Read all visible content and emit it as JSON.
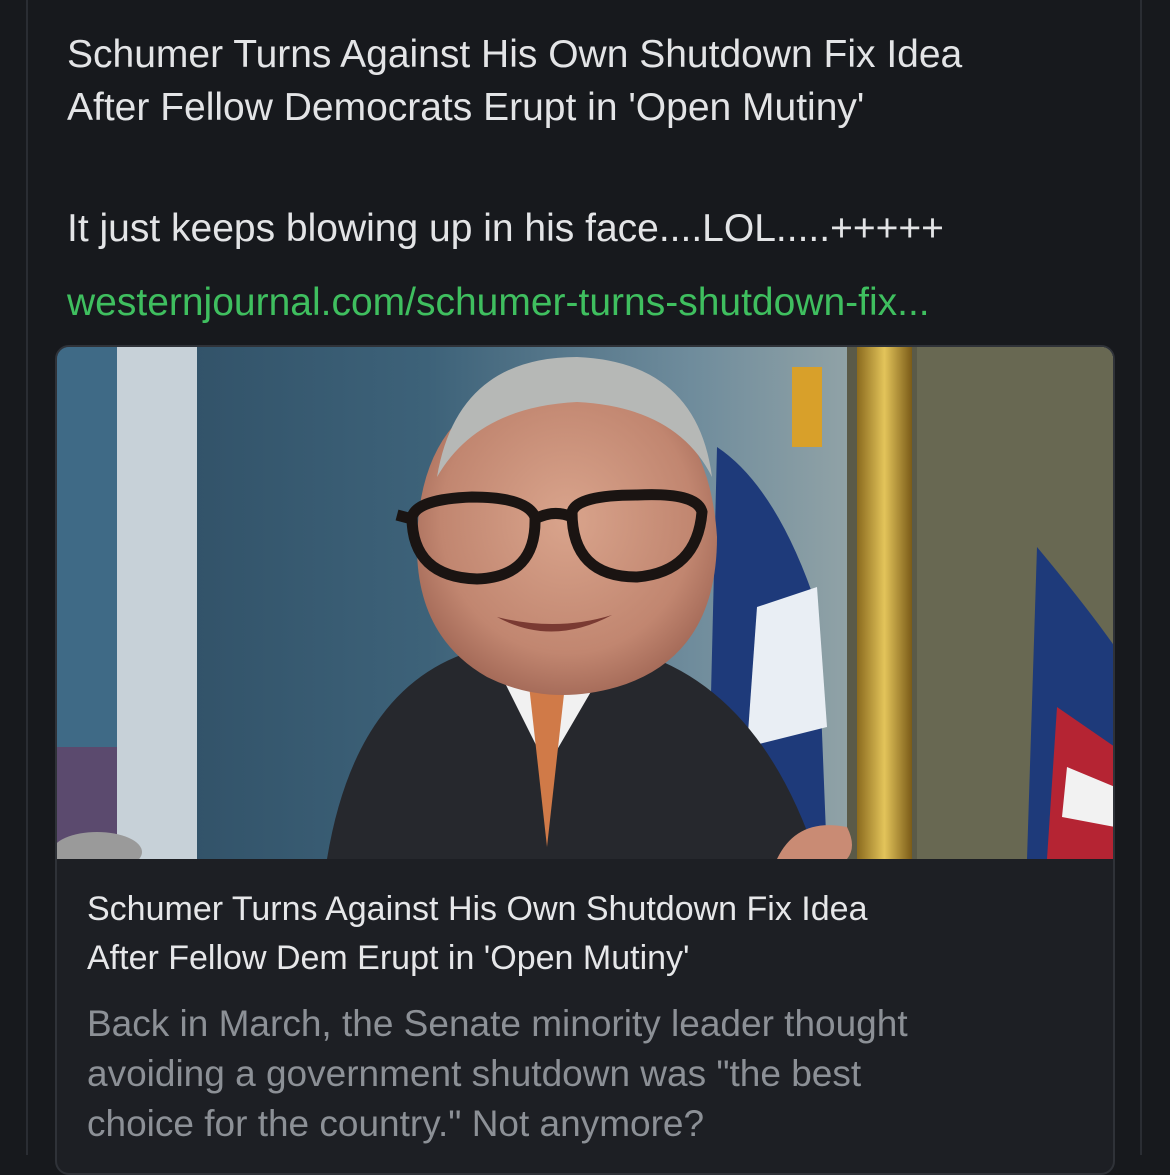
{
  "post": {
    "text_line1": "Schumer Turns Against His Own Shutdown Fix Idea",
    "text_line2": "After Fellow Democrats Erupt in 'Open Mutiny'",
    "comment": "It just keeps blowing up in his face....LOL.....+++++",
    "link_text": "westernjournal.com/schumer-turns-shutdown-fix..."
  },
  "card": {
    "title_line1": "Schumer Turns Against His Own Shutdown Fix Idea",
    "title_line2": "After Fellow Dem Erupt in 'Open Mutiny'",
    "desc_line1": "Back in March, the Senate minority leader thought",
    "desc_line2": "avoiding a government shutdown was \"the best",
    "desc_line3": "choice for the country.\" Not anymore?"
  },
  "colors": {
    "background": "#17191d",
    "link": "#3fbf5f",
    "card_background": "#1d1f24"
  }
}
